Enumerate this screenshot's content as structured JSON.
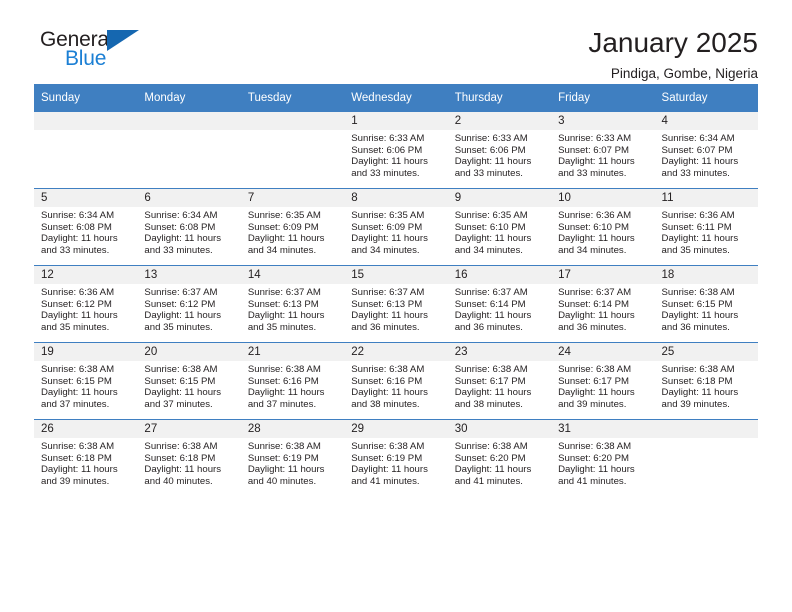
{
  "logo": {
    "word_one": "General",
    "word_two": "Blue",
    "triangle_color": "#1567b0",
    "blue_text_color": "#1b7fd4"
  },
  "header": {
    "title": "January 2025",
    "subtitle": "Pindiga, Gombe, Nigeria"
  },
  "theme": {
    "header_blue": "#3f7fc1",
    "daynum_band": "#f1f1f1",
    "text": "#231f20"
  },
  "weekday_headers": [
    "Sunday",
    "Monday",
    "Tuesday",
    "Wednesday",
    "Thursday",
    "Friday",
    "Saturday"
  ],
  "weeks": [
    [
      {
        "day": "",
        "sunrise": "",
        "sunset": "",
        "daylight_line1": "",
        "daylight_line2": ""
      },
      {
        "day": "",
        "sunrise": "",
        "sunset": "",
        "daylight_line1": "",
        "daylight_line2": ""
      },
      {
        "day": "",
        "sunrise": "",
        "sunset": "",
        "daylight_line1": "",
        "daylight_line2": ""
      },
      {
        "day": "1",
        "sunrise": "Sunrise: 6:33 AM",
        "sunset": "Sunset: 6:06 PM",
        "daylight_line1": "Daylight: 11 hours",
        "daylight_line2": "and 33 minutes."
      },
      {
        "day": "2",
        "sunrise": "Sunrise: 6:33 AM",
        "sunset": "Sunset: 6:06 PM",
        "daylight_line1": "Daylight: 11 hours",
        "daylight_line2": "and 33 minutes."
      },
      {
        "day": "3",
        "sunrise": "Sunrise: 6:33 AM",
        "sunset": "Sunset: 6:07 PM",
        "daylight_line1": "Daylight: 11 hours",
        "daylight_line2": "and 33 minutes."
      },
      {
        "day": "4",
        "sunrise": "Sunrise: 6:34 AM",
        "sunset": "Sunset: 6:07 PM",
        "daylight_line1": "Daylight: 11 hours",
        "daylight_line2": "and 33 minutes."
      }
    ],
    [
      {
        "day": "5",
        "sunrise": "Sunrise: 6:34 AM",
        "sunset": "Sunset: 6:08 PM",
        "daylight_line1": "Daylight: 11 hours",
        "daylight_line2": "and 33 minutes."
      },
      {
        "day": "6",
        "sunrise": "Sunrise: 6:34 AM",
        "sunset": "Sunset: 6:08 PM",
        "daylight_line1": "Daylight: 11 hours",
        "daylight_line2": "and 33 minutes."
      },
      {
        "day": "7",
        "sunrise": "Sunrise: 6:35 AM",
        "sunset": "Sunset: 6:09 PM",
        "daylight_line1": "Daylight: 11 hours",
        "daylight_line2": "and 34 minutes."
      },
      {
        "day": "8",
        "sunrise": "Sunrise: 6:35 AM",
        "sunset": "Sunset: 6:09 PM",
        "daylight_line1": "Daylight: 11 hours",
        "daylight_line2": "and 34 minutes."
      },
      {
        "day": "9",
        "sunrise": "Sunrise: 6:35 AM",
        "sunset": "Sunset: 6:10 PM",
        "daylight_line1": "Daylight: 11 hours",
        "daylight_line2": "and 34 minutes."
      },
      {
        "day": "10",
        "sunrise": "Sunrise: 6:36 AM",
        "sunset": "Sunset: 6:10 PM",
        "daylight_line1": "Daylight: 11 hours",
        "daylight_line2": "and 34 minutes."
      },
      {
        "day": "11",
        "sunrise": "Sunrise: 6:36 AM",
        "sunset": "Sunset: 6:11 PM",
        "daylight_line1": "Daylight: 11 hours",
        "daylight_line2": "and 35 minutes."
      }
    ],
    [
      {
        "day": "12",
        "sunrise": "Sunrise: 6:36 AM",
        "sunset": "Sunset: 6:12 PM",
        "daylight_line1": "Daylight: 11 hours",
        "daylight_line2": "and 35 minutes."
      },
      {
        "day": "13",
        "sunrise": "Sunrise: 6:37 AM",
        "sunset": "Sunset: 6:12 PM",
        "daylight_line1": "Daylight: 11 hours",
        "daylight_line2": "and 35 minutes."
      },
      {
        "day": "14",
        "sunrise": "Sunrise: 6:37 AM",
        "sunset": "Sunset: 6:13 PM",
        "daylight_line1": "Daylight: 11 hours",
        "daylight_line2": "and 35 minutes."
      },
      {
        "day": "15",
        "sunrise": "Sunrise: 6:37 AM",
        "sunset": "Sunset: 6:13 PM",
        "daylight_line1": "Daylight: 11 hours",
        "daylight_line2": "and 36 minutes."
      },
      {
        "day": "16",
        "sunrise": "Sunrise: 6:37 AM",
        "sunset": "Sunset: 6:14 PM",
        "daylight_line1": "Daylight: 11 hours",
        "daylight_line2": "and 36 minutes."
      },
      {
        "day": "17",
        "sunrise": "Sunrise: 6:37 AM",
        "sunset": "Sunset: 6:14 PM",
        "daylight_line1": "Daylight: 11 hours",
        "daylight_line2": "and 36 minutes."
      },
      {
        "day": "18",
        "sunrise": "Sunrise: 6:38 AM",
        "sunset": "Sunset: 6:15 PM",
        "daylight_line1": "Daylight: 11 hours",
        "daylight_line2": "and 36 minutes."
      }
    ],
    [
      {
        "day": "19",
        "sunrise": "Sunrise: 6:38 AM",
        "sunset": "Sunset: 6:15 PM",
        "daylight_line1": "Daylight: 11 hours",
        "daylight_line2": "and 37 minutes."
      },
      {
        "day": "20",
        "sunrise": "Sunrise: 6:38 AM",
        "sunset": "Sunset: 6:15 PM",
        "daylight_line1": "Daylight: 11 hours",
        "daylight_line2": "and 37 minutes."
      },
      {
        "day": "21",
        "sunrise": "Sunrise: 6:38 AM",
        "sunset": "Sunset: 6:16 PM",
        "daylight_line1": "Daylight: 11 hours",
        "daylight_line2": "and 37 minutes."
      },
      {
        "day": "22",
        "sunrise": "Sunrise: 6:38 AM",
        "sunset": "Sunset: 6:16 PM",
        "daylight_line1": "Daylight: 11 hours",
        "daylight_line2": "and 38 minutes."
      },
      {
        "day": "23",
        "sunrise": "Sunrise: 6:38 AM",
        "sunset": "Sunset: 6:17 PM",
        "daylight_line1": "Daylight: 11 hours",
        "daylight_line2": "and 38 minutes."
      },
      {
        "day": "24",
        "sunrise": "Sunrise: 6:38 AM",
        "sunset": "Sunset: 6:17 PM",
        "daylight_line1": "Daylight: 11 hours",
        "daylight_line2": "and 39 minutes."
      },
      {
        "day": "25",
        "sunrise": "Sunrise: 6:38 AM",
        "sunset": "Sunset: 6:18 PM",
        "daylight_line1": "Daylight: 11 hours",
        "daylight_line2": "and 39 minutes."
      }
    ],
    [
      {
        "day": "26",
        "sunrise": "Sunrise: 6:38 AM",
        "sunset": "Sunset: 6:18 PM",
        "daylight_line1": "Daylight: 11 hours",
        "daylight_line2": "and 39 minutes."
      },
      {
        "day": "27",
        "sunrise": "Sunrise: 6:38 AM",
        "sunset": "Sunset: 6:18 PM",
        "daylight_line1": "Daylight: 11 hours",
        "daylight_line2": "and 40 minutes."
      },
      {
        "day": "28",
        "sunrise": "Sunrise: 6:38 AM",
        "sunset": "Sunset: 6:19 PM",
        "daylight_line1": "Daylight: 11 hours",
        "daylight_line2": "and 40 minutes."
      },
      {
        "day": "29",
        "sunrise": "Sunrise: 6:38 AM",
        "sunset": "Sunset: 6:19 PM",
        "daylight_line1": "Daylight: 11 hours",
        "daylight_line2": "and 41 minutes."
      },
      {
        "day": "30",
        "sunrise": "Sunrise: 6:38 AM",
        "sunset": "Sunset: 6:20 PM",
        "daylight_line1": "Daylight: 11 hours",
        "daylight_line2": "and 41 minutes."
      },
      {
        "day": "31",
        "sunrise": "Sunrise: 6:38 AM",
        "sunset": "Sunset: 6:20 PM",
        "daylight_line1": "Daylight: 11 hours",
        "daylight_line2": "and 41 minutes."
      },
      {
        "day": "",
        "sunrise": "",
        "sunset": "",
        "daylight_line1": "",
        "daylight_line2": ""
      }
    ]
  ]
}
